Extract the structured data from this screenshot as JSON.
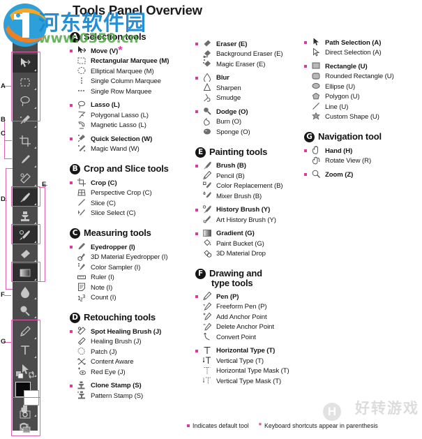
{
  "title": "Tools Panel Overview",
  "watermark": {
    "cn": "河东软件园",
    "url": "www.0350.cn",
    "bottom_right": "好转游戏",
    "badge": "H"
  },
  "footer": {
    "default_tool_note": "Indicates default tool",
    "shortcut_note": "Keyboard shortcuts appear in parenthesis",
    "star": "*"
  },
  "accent_pink": "#e6359a",
  "bracket_pink": "#e05fae",
  "toolbar": {
    "panel_bg": "#4b4b4b",
    "group_labels": [
      "A",
      "B",
      "C",
      "D",
      "E",
      "F",
      "G"
    ],
    "tools": [
      "move-tool",
      "rectangular-marquee-tool",
      "lasso-tool",
      "quick-selection-tool",
      "crop-tool",
      "eyedropper-tool",
      "spot-healing-brush-tool",
      "brush-tool",
      "clone-stamp-tool",
      "history-brush-tool",
      "eraser-tool",
      "gradient-tool",
      "blur-tool",
      "dodge-tool",
      "pen-tool",
      "horizontal-type-tool",
      "path-selection-tool",
      "rectangle-tool",
      "hand-tool",
      "zoom-tool"
    ],
    "bottom": [
      "foreground-background-color",
      "quick-mask-mode",
      "screen-mode"
    ]
  },
  "sections": [
    {
      "letter": "A",
      "title": "Selection tools",
      "column": 0,
      "groups": [
        {
          "items": [
            {
              "label": "Move (V)",
              "default": true,
              "star": true,
              "icon": "move-icon"
            },
            {
              "label": "Rectangular Marquee (M)",
              "default": false,
              "bold": true,
              "icon": "rect-marquee-icon"
            },
            {
              "label": "Elliptical Marquee (M)",
              "default": false,
              "icon": "ellipse-marquee-icon"
            },
            {
              "label": "Single Column Marquee",
              "default": false,
              "icon": "single-column-marquee-icon"
            },
            {
              "label": "Single Row Marquee",
              "default": false,
              "icon": "single-row-marquee-icon"
            }
          ]
        },
        {
          "items": [
            {
              "label": "Lasso (L)",
              "default": true,
              "icon": "lasso-icon"
            },
            {
              "label": "Polygonal Lasso (L)",
              "default": false,
              "icon": "polygonal-lasso-icon"
            },
            {
              "label": "Magnetic Lasso (L)",
              "default": false,
              "icon": "magnetic-lasso-icon"
            }
          ]
        },
        {
          "items": [
            {
              "label": "Quick Selection (W)",
              "default": true,
              "icon": "quick-selection-icon"
            },
            {
              "label": "Magic Wand (W)",
              "default": false,
              "icon": "magic-wand-icon"
            }
          ]
        }
      ]
    },
    {
      "letter": "B",
      "title": "Crop and Slice tools",
      "column": 0,
      "groups": [
        {
          "items": [
            {
              "label": "Crop (C)",
              "default": true,
              "icon": "crop-icon"
            },
            {
              "label": "Perspective Crop (C)",
              "default": false,
              "icon": "perspective-crop-icon"
            },
            {
              "label": "Slice (C)",
              "default": false,
              "icon": "slice-icon"
            },
            {
              "label": "Slice Select (C)",
              "default": false,
              "icon": "slice-select-icon"
            }
          ]
        }
      ]
    },
    {
      "letter": "C",
      "title": "Measuring tools",
      "column": 0,
      "groups": [
        {
          "items": [
            {
              "label": "Eyedropper (I)",
              "default": true,
              "icon": "eyedropper-icon"
            },
            {
              "label": "3D Material Eyedropper (I)",
              "default": false,
              "icon": "3d-material-eyedropper-icon"
            },
            {
              "label": "Color Sampler (I)",
              "default": false,
              "icon": "color-sampler-icon"
            },
            {
              "label": "Ruler (I)",
              "default": false,
              "icon": "ruler-icon"
            },
            {
              "label": "Note (I)",
              "default": false,
              "icon": "note-icon"
            },
            {
              "label": "Count (I)",
              "default": false,
              "icon": "count-icon"
            }
          ]
        }
      ]
    },
    {
      "letter": "D",
      "title": "Retouching tools",
      "column": 0,
      "groups": [
        {
          "items": [
            {
              "label": "Spot Healing Brush (J)",
              "default": true,
              "icon": "spot-healing-brush-icon"
            },
            {
              "label": "Healing Brush (J)",
              "default": false,
              "icon": "healing-brush-icon"
            },
            {
              "label": "Patch (J)",
              "default": false,
              "icon": "patch-icon"
            },
            {
              "label": "Content Aware",
              "default": false,
              "icon": "content-aware-move-icon"
            },
            {
              "label": "Red Eye (J)",
              "default": false,
              "icon": "red-eye-icon"
            }
          ]
        },
        {
          "items": [
            {
              "label": "Clone Stamp (S)",
              "default": true,
              "icon": "clone-stamp-icon"
            },
            {
              "label": "Pattern Stamp (S)",
              "default": false,
              "icon": "pattern-stamp-icon"
            }
          ]
        }
      ]
    },
    {
      "letter": "",
      "title": "",
      "column": 1,
      "groups": [
        {
          "items": [
            {
              "label": "Eraser (E)",
              "default": true,
              "icon": "eraser-icon"
            },
            {
              "label": "Background Eraser (E)",
              "default": false,
              "icon": "background-eraser-icon"
            },
            {
              "label": "Magic Eraser (E)",
              "default": false,
              "icon": "magic-eraser-icon"
            }
          ]
        },
        {
          "items": [
            {
              "label": "Blur",
              "default": true,
              "icon": "blur-icon"
            },
            {
              "label": "Sharpen",
              "default": false,
              "icon": "sharpen-icon"
            },
            {
              "label": "Smudge",
              "default": false,
              "icon": "smudge-icon"
            }
          ]
        },
        {
          "items": [
            {
              "label": "Dodge (O)",
              "default": true,
              "icon": "dodge-icon"
            },
            {
              "label": "Burn (O)",
              "default": false,
              "icon": "burn-icon"
            },
            {
              "label": "Sponge (O)",
              "default": false,
              "icon": "sponge-icon"
            }
          ]
        }
      ]
    },
    {
      "letter": "E",
      "title": "Painting tools",
      "column": 1,
      "groups": [
        {
          "items": [
            {
              "label": "Brush (B)",
              "default": true,
              "icon": "brush-icon"
            },
            {
              "label": "Pencil (B)",
              "default": false,
              "icon": "pencil-icon"
            },
            {
              "label": "Color Replacement (B)",
              "default": false,
              "icon": "color-replacement-icon"
            },
            {
              "label": "Mixer Brush (B)",
              "default": false,
              "icon": "mixer-brush-icon"
            }
          ]
        },
        {
          "items": [
            {
              "label": "History Brush (Y)",
              "default": true,
              "icon": "history-brush-icon"
            },
            {
              "label": "Art History Brush (Y)",
              "default": false,
              "icon": "art-history-brush-icon"
            }
          ]
        },
        {
          "items": [
            {
              "label": "Gradient (G)",
              "default": true,
              "icon": "gradient-icon"
            },
            {
              "label": "Paint Bucket (G)",
              "default": false,
              "icon": "paint-bucket-icon"
            },
            {
              "label": "3D Material Drop",
              "default": false,
              "icon": "3d-material-drop-icon"
            }
          ]
        }
      ]
    },
    {
      "letter": "F",
      "title": "Drawing and type tools",
      "title_line1": "Drawing and",
      "title_line2": "type tools",
      "column": 1,
      "groups": [
        {
          "items": [
            {
              "label": "Pen (P)",
              "default": true,
              "icon": "pen-icon"
            },
            {
              "label": "Freeform Pen (P)",
              "default": false,
              "icon": "freeform-pen-icon"
            },
            {
              "label": "Add Anchor Point",
              "default": false,
              "icon": "add-anchor-point-icon"
            },
            {
              "label": "Delete Anchor Point",
              "default": false,
              "icon": "delete-anchor-point-icon"
            },
            {
              "label": "Convert Point",
              "default": false,
              "icon": "convert-point-icon"
            }
          ]
        },
        {
          "items": [
            {
              "label": "Horizontal Type (T)",
              "default": true,
              "icon": "horizontal-type-icon"
            },
            {
              "label": "Vertical Type (T)",
              "default": false,
              "icon": "vertical-type-icon"
            },
            {
              "label": "Horizontal Type Mask (T)",
              "default": false,
              "icon": "horizontal-type-mask-icon"
            },
            {
              "label": "Vertical Type Mask (T)",
              "default": false,
              "icon": "vertical-type-mask-icon"
            }
          ]
        }
      ]
    },
    {
      "letter": "",
      "title": "",
      "column": 2,
      "groups": [
        {
          "items": [
            {
              "label": "Path Selection (A)",
              "default": true,
              "icon": "path-selection-icon"
            },
            {
              "label": "Direct Selection (A)",
              "default": false,
              "icon": "direct-selection-icon"
            }
          ]
        },
        {
          "items": [
            {
              "label": "Rectangle (U)",
              "default": true,
              "icon": "rectangle-icon"
            },
            {
              "label": "Rounded Rectangle (U)",
              "default": false,
              "icon": "rounded-rectangle-icon"
            },
            {
              "label": "Ellipse (U)",
              "default": false,
              "icon": "ellipse-icon"
            },
            {
              "label": "Polygon (U)",
              "default": false,
              "icon": "polygon-icon"
            },
            {
              "label": "Line (U)",
              "default": false,
              "icon": "line-icon"
            },
            {
              "label": "Custom Shape (U)",
              "default": false,
              "icon": "custom-shape-icon"
            }
          ]
        }
      ]
    },
    {
      "letter": "G",
      "title": "Navigation tool",
      "column": 2,
      "groups": [
        {
          "items": [
            {
              "label": "Hand (H)",
              "default": true,
              "icon": "hand-icon"
            },
            {
              "label": "Rotate View (R)",
              "default": false,
              "icon": "rotate-view-icon"
            }
          ]
        },
        {
          "items": [
            {
              "label": "Zoom (Z)",
              "default": true,
              "icon": "zoom-icon"
            }
          ]
        }
      ]
    }
  ]
}
